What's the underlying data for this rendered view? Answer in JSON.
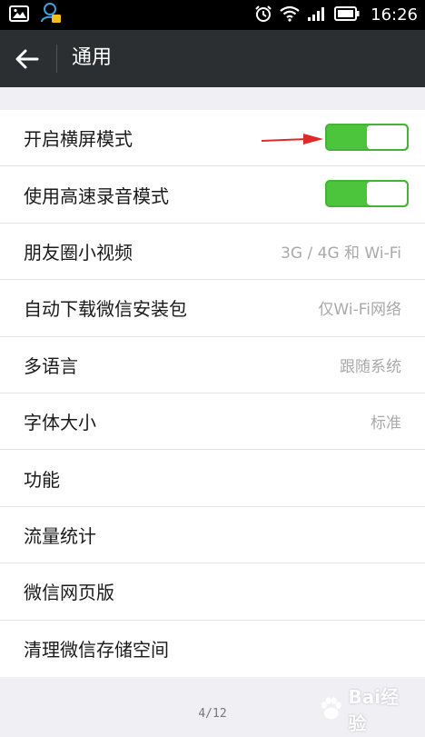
{
  "status_bar": {
    "time": "16:26",
    "left_icons": [
      "image-notification-icon",
      "wechat-notification-icon"
    ],
    "right_icons": [
      "alarm-icon",
      "wifi-icon",
      "signal-icon",
      "battery-icon"
    ]
  },
  "app_bar": {
    "title": "通用",
    "back_icon": "back-arrow-icon"
  },
  "settings": {
    "items": [
      {
        "label": "开启横屏模式",
        "type": "toggle",
        "enabled": true
      },
      {
        "label": "使用高速录音模式",
        "type": "toggle",
        "enabled": true
      },
      {
        "label": "朋友圈小视频",
        "value": "3G / 4G 和 Wi-Fi"
      },
      {
        "label": "自动下载微信安装包",
        "value": "仅Wi-Fi网络"
      },
      {
        "label": "多语言",
        "value": "跟随系统"
      },
      {
        "label": "字体大小",
        "value": "标准"
      },
      {
        "label": "功能",
        "value": ""
      },
      {
        "label": "流量统计",
        "value": ""
      },
      {
        "label": "微信网页版",
        "value": ""
      },
      {
        "label": "清理微信存储空间",
        "value": ""
      }
    ]
  },
  "footer": {
    "page_indicator": "4/12",
    "watermark": "Bai经验"
  },
  "colors": {
    "app_bar": "#2b2f31",
    "toggle_on": "#4cc43b",
    "annotation_arrow": "#e02a2a",
    "background": "#efeff4"
  }
}
